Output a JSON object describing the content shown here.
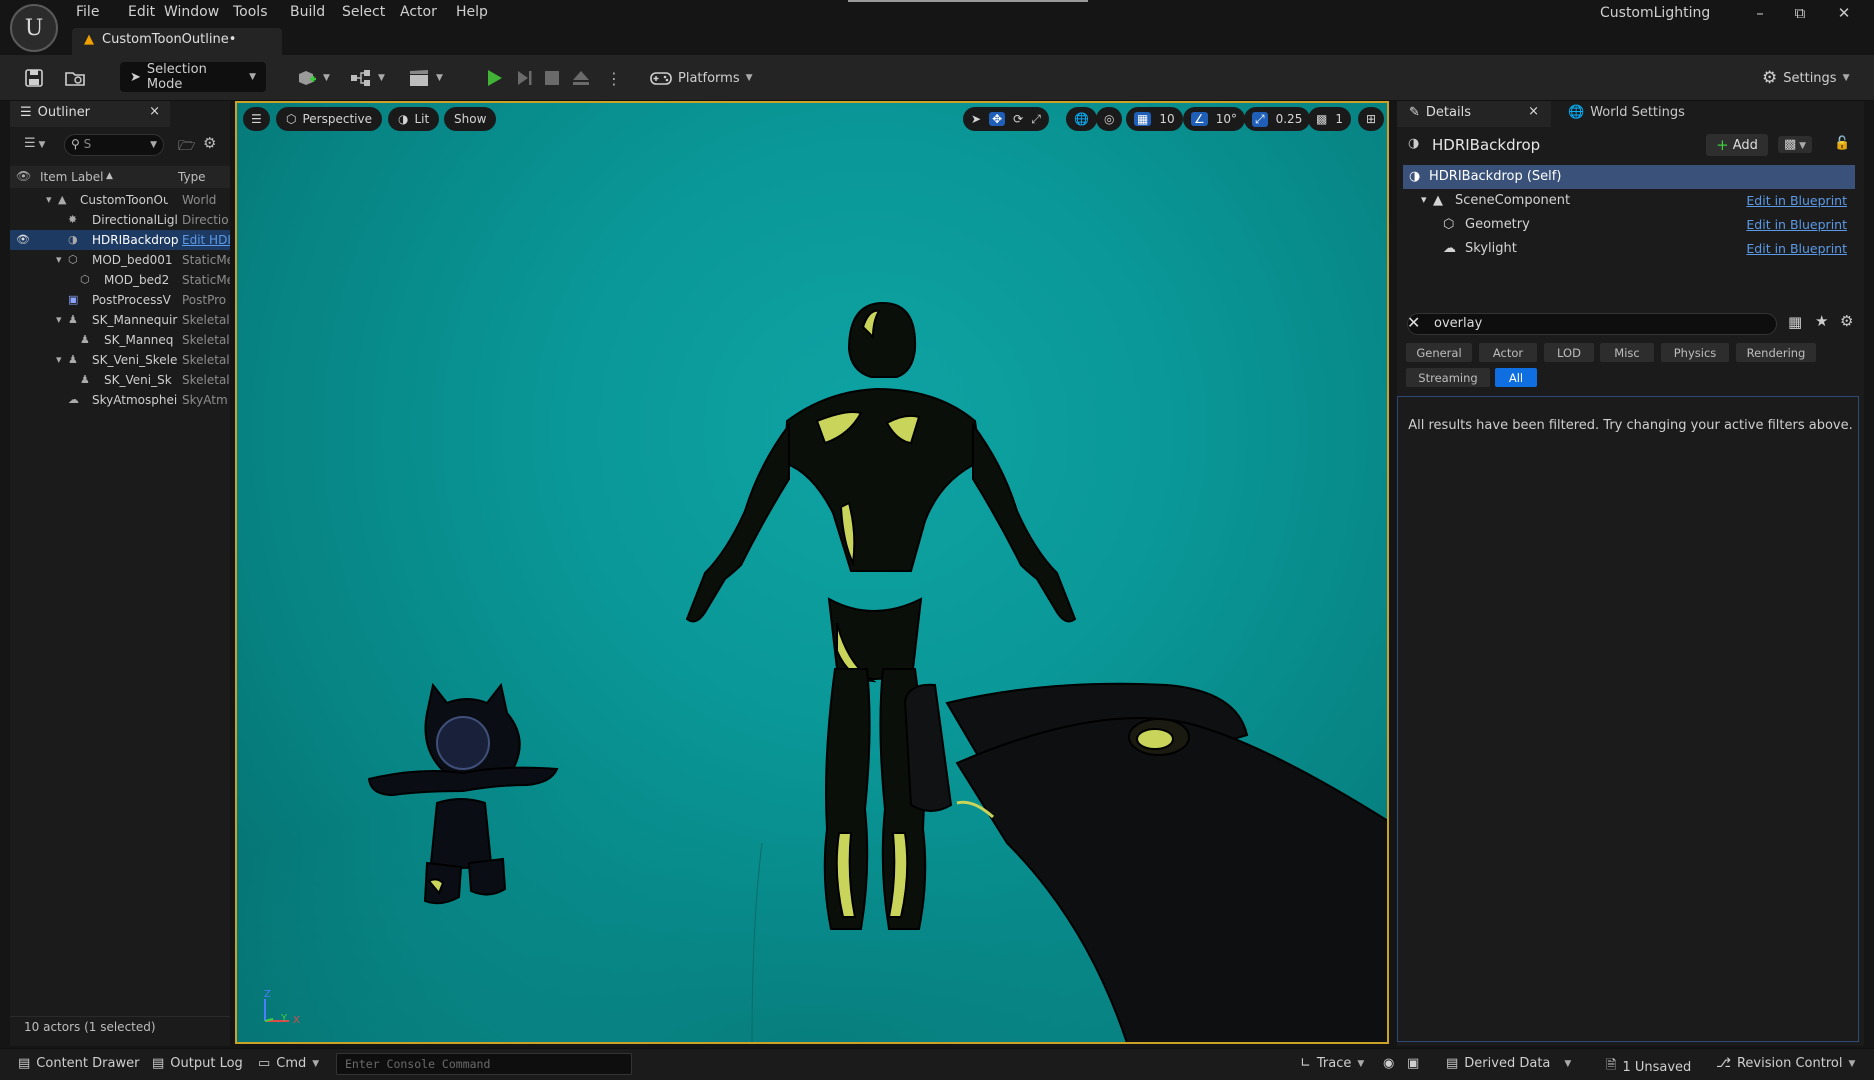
{
  "menu": [
    "File",
    "Edit",
    "Window",
    "Tools",
    "Build",
    "Select",
    "Actor",
    "Help"
  ],
  "project_name": "CustomLighting",
  "document_tab": "CustomToonOutline•",
  "window_controls": {
    "minimize": "–",
    "maximize": "⧉",
    "close": "✕"
  },
  "toolbar": {
    "selection_mode": "Selection Mode",
    "platforms": "Platforms",
    "settings": "Settings"
  },
  "outliner": {
    "tab_label": "Outliner",
    "close": "×",
    "search_value": "S",
    "col_label": "Item Label",
    "col_sort": "▲",
    "col_type": "Type",
    "rows": [
      {
        "label": "CustomToonOut",
        "type": "World"
      },
      {
        "label": "DirectionalLigl",
        "type": "Directio"
      },
      {
        "label": "HDRIBackdrop",
        "type": "Edit HDI"
      },
      {
        "label": "MOD_bed001",
        "type": "StaticMe"
      },
      {
        "label": "MOD_bed2",
        "type": "StaticMe"
      },
      {
        "label": "PostProcessV",
        "type": "PostPro"
      },
      {
        "label": "SK_Mannequir",
        "type": "Skeletal"
      },
      {
        "label": "SK_Manneq",
        "type": "Skeletal"
      },
      {
        "label": "SK_Veni_Skele",
        "type": "Skeletal"
      },
      {
        "label": "SK_Veni_Sk",
        "type": "Skeletal"
      },
      {
        "label": "SkyAtmosphei",
        "type": "SkyAtm"
      }
    ],
    "footer": "10 actors (1 selected)"
  },
  "viewport": {
    "perspective": "Perspective",
    "lit": "Lit",
    "show": "Show",
    "grid_snap": "10",
    "rot_snap": "10°",
    "scale_snap": "0.25",
    "camera_speed": "1",
    "axis_z": "Z",
    "axis_y": "Y",
    "axis_x": "X"
  },
  "details": {
    "tab_label": "Details",
    "close": "×",
    "world_tab": "World Settings",
    "actor_name": "HDRIBackdrop",
    "add_label": "Add",
    "components": [
      {
        "label": "HDRIBackdrop (Self)",
        "bp": ""
      },
      {
        "label": "SceneComponent",
        "bp": "Edit in Blueprint"
      },
      {
        "label": "Geometry",
        "bp": "Edit in Blueprint"
      },
      {
        "label": "Skylight",
        "bp": "Edit in Blueprint"
      }
    ],
    "filter_value": "overlay",
    "chips": [
      "General",
      "Actor",
      "LOD",
      "Misc",
      "Physics",
      "Rendering",
      "Streaming",
      "All"
    ],
    "message": "All results have been filtered. Try changing your active filters above."
  },
  "statusbar": {
    "content_drawer": "Content Drawer",
    "output_log": "Output Log",
    "cmd": "Cmd",
    "console_placeholder": "Enter Console Command",
    "trace": "Trace",
    "derived_data": "Derived Data",
    "unsaved": "1 Unsaved",
    "revision_control": "Revision Control"
  },
  "colors": {
    "accent": "#0f6fe0",
    "viewport_bg": "#0a9797",
    "viewport_border": "#c9a227",
    "highlight": "#c8d45a"
  }
}
